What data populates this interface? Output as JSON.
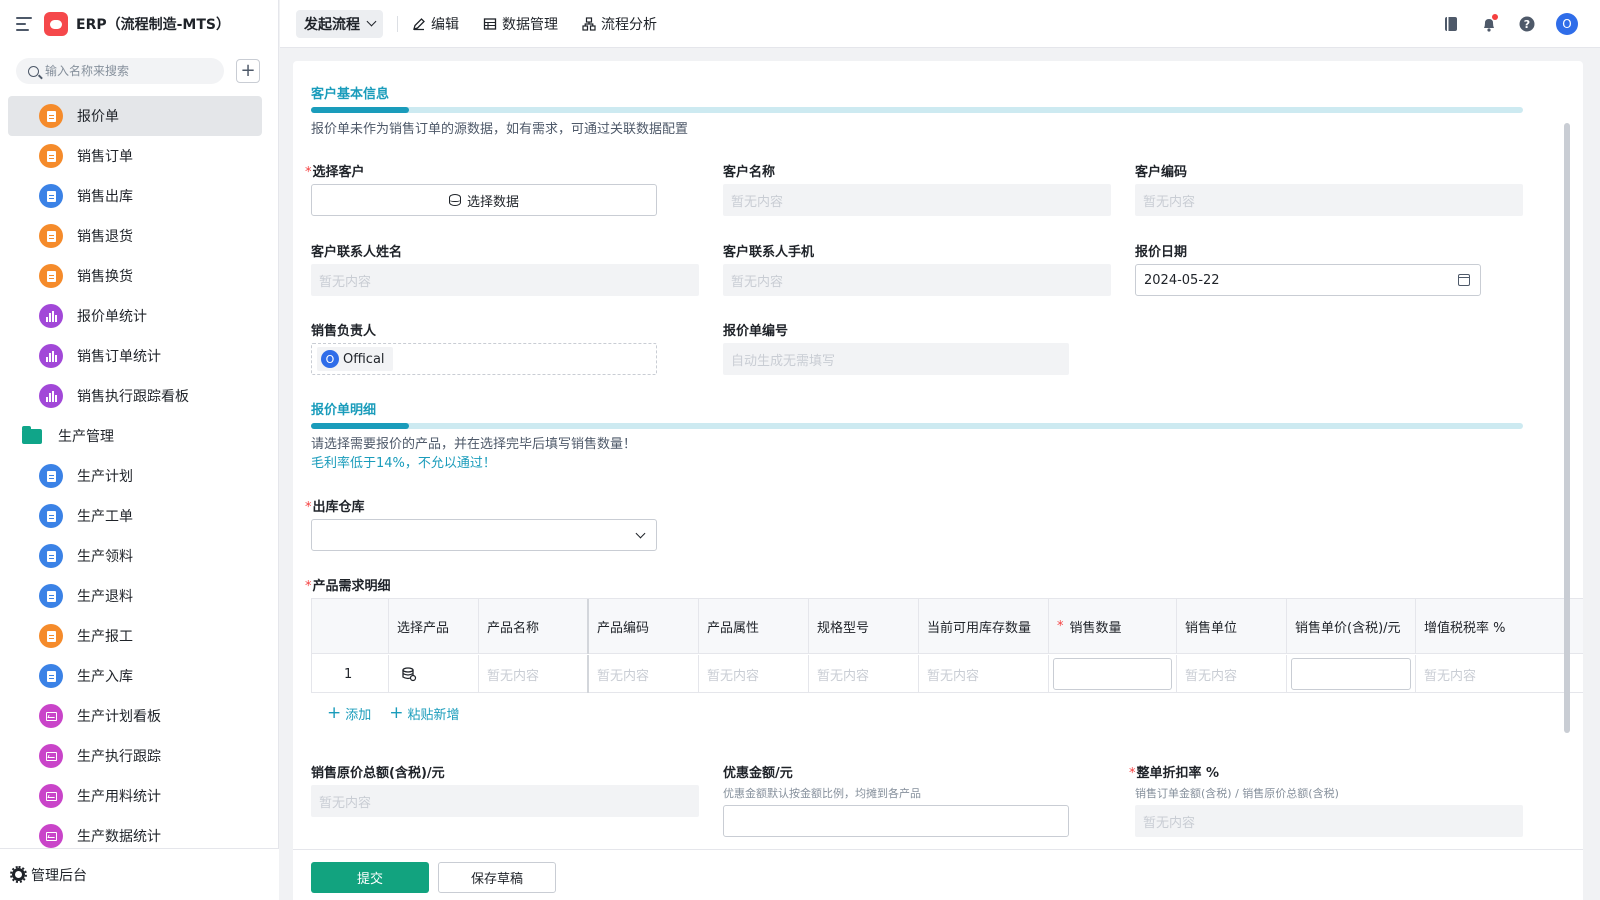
{
  "app": {
    "title": "ERP（流程制造-MTS）"
  },
  "sidebar": {
    "search_placeholder": "输入名称来搜索",
    "items": [
      {
        "label": "报价单",
        "icon": "document-icon",
        "color": "orange",
        "active": true
      },
      {
        "label": "销售订单",
        "icon": "document-icon",
        "color": "orange"
      },
      {
        "label": "销售出库",
        "icon": "document-icon",
        "color": "blue"
      },
      {
        "label": "销售退货",
        "icon": "document-icon",
        "color": "orange"
      },
      {
        "label": "销售换货",
        "icon": "document-icon",
        "color": "orange"
      },
      {
        "label": "报价单统计",
        "icon": "bar-chart-icon",
        "color": "purple"
      },
      {
        "label": "销售订单统计",
        "icon": "bar-chart-icon",
        "color": "purple"
      },
      {
        "label": "销售执行跟踪看板",
        "icon": "bar-chart-icon",
        "color": "purple"
      },
      {
        "label": "生产管理",
        "icon": "folder-icon",
        "color": "green",
        "group": true
      },
      {
        "label": "生产计划",
        "icon": "document-icon",
        "color": "blue"
      },
      {
        "label": "生产工单",
        "icon": "document-icon",
        "color": "blue"
      },
      {
        "label": "生产领料",
        "icon": "document-icon",
        "color": "blue"
      },
      {
        "label": "生产退料",
        "icon": "document-icon",
        "color": "blue"
      },
      {
        "label": "生产报工",
        "icon": "document-icon",
        "color": "orange"
      },
      {
        "label": "生产入库",
        "icon": "document-icon",
        "color": "blue"
      },
      {
        "label": "生产计划看板",
        "icon": "dashboard-icon",
        "color": "magenta"
      },
      {
        "label": "生产执行跟踪",
        "icon": "dashboard-icon",
        "color": "magenta"
      },
      {
        "label": "生产用料统计",
        "icon": "dashboard-icon",
        "color": "magenta"
      },
      {
        "label": "生产数据统计",
        "icon": "dashboard-icon",
        "color": "magenta"
      }
    ],
    "footer": "管理后台"
  },
  "topbar": {
    "launch": "发起流程",
    "tools": [
      "编辑",
      "数据管理",
      "流程分析"
    ],
    "avatar": "O"
  },
  "form": {
    "section1": {
      "title": "客户基本信息",
      "desc": "报价单未作为销售订单的源数据，如有需求，可通过关联数据配置"
    },
    "fields": {
      "select_customer": {
        "label": "选择客户",
        "button": "选择数据"
      },
      "customer_name": {
        "label": "客户名称",
        "value": "暂无内容"
      },
      "customer_code": {
        "label": "客户编码",
        "value": "暂无内容"
      },
      "contact_name": {
        "label": "客户联系人姓名",
        "value": "暂无内容"
      },
      "contact_phone": {
        "label": "客户联系人手机",
        "value": "暂无内容"
      },
      "quote_date": {
        "label": "报价日期",
        "value": "2024-05-22"
      },
      "sales_owner": {
        "label": "销售负责人",
        "user_initial": "O",
        "user_name": "Offical"
      },
      "quote_no": {
        "label": "报价单编号",
        "value": "自动生成无需填写"
      }
    },
    "section2": {
      "title": "报价单明细",
      "desc": "请选择需要报价的产品，并在选择完毕后填写销售数量！",
      "warning": "毛利率低于14%，不允以通过！"
    },
    "warehouse": {
      "label": "出库仓库",
      "value": ""
    },
    "details": {
      "label": "产品需求明细",
      "columns": [
        "选择产品",
        "产品名称",
        "产品编码",
        "产品属性",
        "规格型号",
        "当前可用库存数量",
        "销售数量",
        "销售单位",
        "销售单价(含税)/元",
        "增值税税率 %"
      ],
      "row": {
        "index": "1",
        "empty": "暂无内容"
      },
      "add": "添加",
      "paste": "粘贴新增"
    },
    "totals": {
      "original_total": {
        "label": "销售原价总额(含税)/元",
        "value": "暂无内容"
      },
      "discount": {
        "label": "优惠金额/元",
        "hint": "优惠金额默认按金额比例，均摊到各产品",
        "value": ""
      },
      "discount_rate": {
        "label": "整单折扣率 %",
        "hint": "销售订单金额(含税) / 销售原价总额(含税)",
        "value": "暂无内容"
      }
    }
  },
  "actions": {
    "submit": "提交",
    "draft": "保存草稿"
  }
}
